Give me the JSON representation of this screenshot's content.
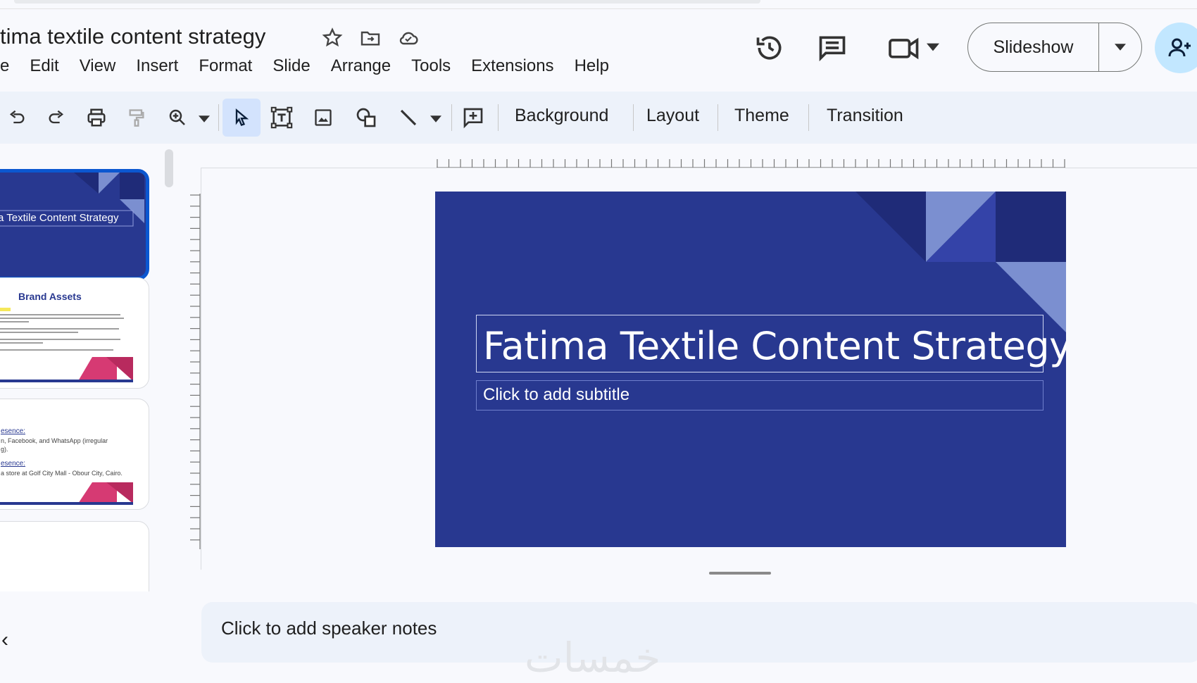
{
  "doc": {
    "title": "tima textile content strategy"
  },
  "menu": [
    "e",
    "Edit",
    "View",
    "Insert",
    "Format",
    "Slide",
    "Arrange",
    "Tools",
    "Extensions",
    "Help"
  ],
  "header": {
    "slideshow_label": "Slideshow"
  },
  "toolbar": {
    "background": "Background",
    "layout": "Layout",
    "theme": "Theme",
    "transition": "Transition"
  },
  "filmstrip": {
    "slide1_title": "a Textile Content Strategy",
    "slide2_title": "Brand Assets",
    "slide3_line1": "esence:",
    "slide3_line2": "n, Facebook, and WhatsApp (irregular",
    "slide3_line3": "g).",
    "slide3_line4": "esence:",
    "slide3_line5": "a store at Golf City Mall - Obour City, Cairo."
  },
  "slide": {
    "title": "Fatima Textile Content Strategy",
    "subtitle_placeholder": "Click to add subtitle",
    "colors": {
      "background": "#283890",
      "accent_light": "#7b8fd0",
      "accent_mid": "#3443a8",
      "accent_dark": "#1f2b78"
    }
  },
  "notes": {
    "placeholder": "Click to add speaker notes"
  },
  "watermark": "خمسات"
}
